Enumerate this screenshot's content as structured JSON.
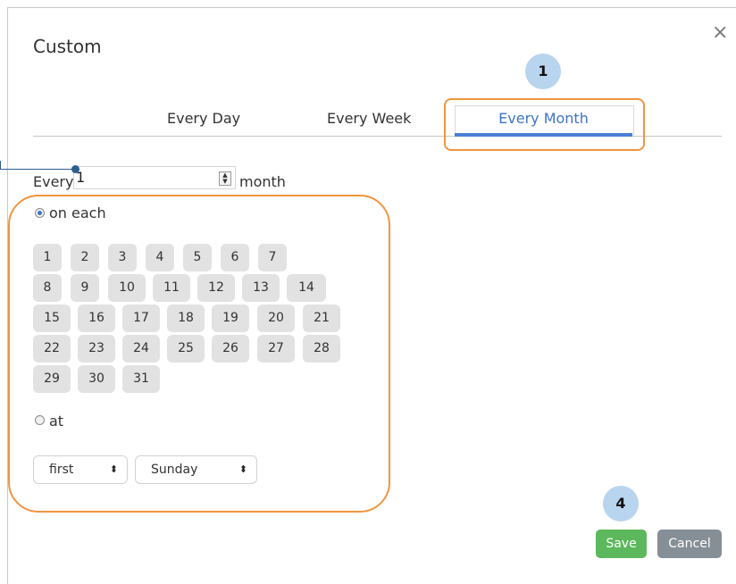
{
  "dialog": {
    "title": "Custom",
    "close_symbol": "×"
  },
  "tabs": [
    {
      "label": "Every Day"
    },
    {
      "label": "Every Week"
    },
    {
      "label": "Every Month",
      "active": true
    }
  ],
  "annotations": {
    "badge_1": "1",
    "badge_4": "4"
  },
  "repeat": {
    "prefix": "Every",
    "value": "1",
    "suffix": "month"
  },
  "options": {
    "on_each_label": "on each",
    "on_each_selected": true,
    "at_label": "at",
    "at_selected": false
  },
  "days": [
    "1",
    "2",
    "3",
    "4",
    "5",
    "6",
    "7",
    "8",
    "9",
    "10",
    "11",
    "12",
    "13",
    "14",
    "15",
    "16",
    "17",
    "18",
    "19",
    "20",
    "21",
    "22",
    "23",
    "24",
    "25",
    "26",
    "27",
    "28",
    "29",
    "30",
    "31"
  ],
  "at_selects": {
    "ordinal": "first",
    "weekday": "Sunday",
    "arrow": "⬍"
  },
  "buttons": {
    "save": "Save",
    "cancel": "Cancel"
  },
  "colors": {
    "accent": "#4a7fd6",
    "highlight": "#f0953f",
    "badge": "#b9d4ee",
    "save": "#5cb85c",
    "cancel": "#868e96"
  }
}
